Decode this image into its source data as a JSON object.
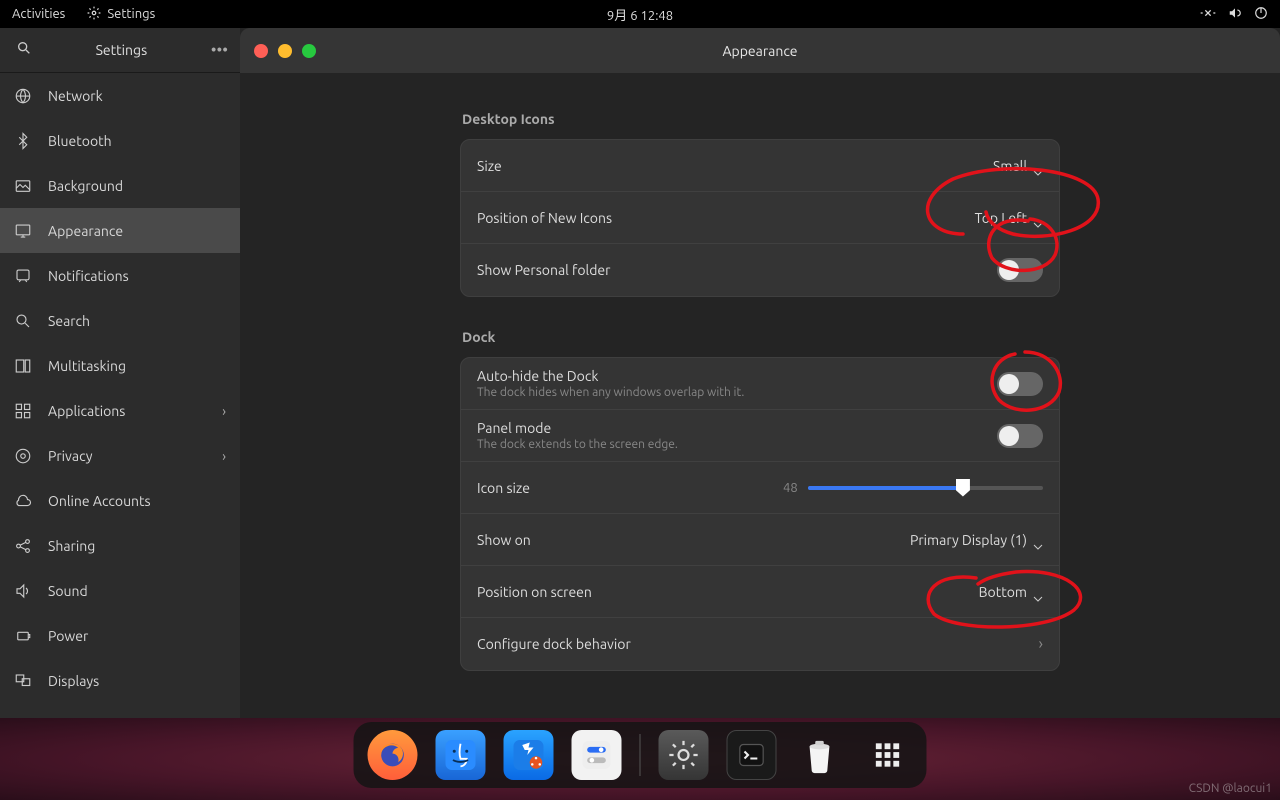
{
  "topbar": {
    "activities": "Activities",
    "app_name": "Settings",
    "clock": "9月 6  12:48"
  },
  "sidebar": {
    "title": "Settings",
    "items": [
      {
        "label": "Network",
        "icon": "network-icon"
      },
      {
        "label": "Bluetooth",
        "icon": "bluetooth-icon"
      },
      {
        "label": "Background",
        "icon": "background-icon"
      },
      {
        "label": "Appearance",
        "icon": "appearance-icon"
      },
      {
        "label": "Notifications",
        "icon": "notifications-icon"
      },
      {
        "label": "Search",
        "icon": "search-icon"
      },
      {
        "label": "Multitasking",
        "icon": "multitasking-icon"
      },
      {
        "label": "Applications",
        "icon": "applications-icon"
      },
      {
        "label": "Privacy",
        "icon": "privacy-icon"
      },
      {
        "label": "Online Accounts",
        "icon": "cloud-icon"
      },
      {
        "label": "Sharing",
        "icon": "sharing-icon"
      },
      {
        "label": "Sound",
        "icon": "sound-icon"
      },
      {
        "label": "Power",
        "icon": "power-icon"
      },
      {
        "label": "Displays",
        "icon": "displays-icon"
      }
    ]
  },
  "content": {
    "title": "Appearance",
    "desktop_icons": {
      "heading": "Desktop Icons",
      "size_label": "Size",
      "size_value": "Small",
      "position_label": "Position of New Icons",
      "position_value": "Top Left",
      "personal_label": "Show Personal folder"
    },
    "dock": {
      "heading": "Dock",
      "autohide_label": "Auto-hide the Dock",
      "autohide_sub": "The dock hides when any windows overlap with it.",
      "panelmode_label": "Panel mode",
      "panelmode_sub": "The dock extends to the screen edge.",
      "iconsize_label": "Icon size",
      "iconsize_value": "48",
      "showon_label": "Show on",
      "showon_value": "Primary Display (1)",
      "position_label": "Position on screen",
      "position_value": "Bottom",
      "configure_label": "Configure dock behavior"
    }
  },
  "watermark": "CSDN @laocui1"
}
